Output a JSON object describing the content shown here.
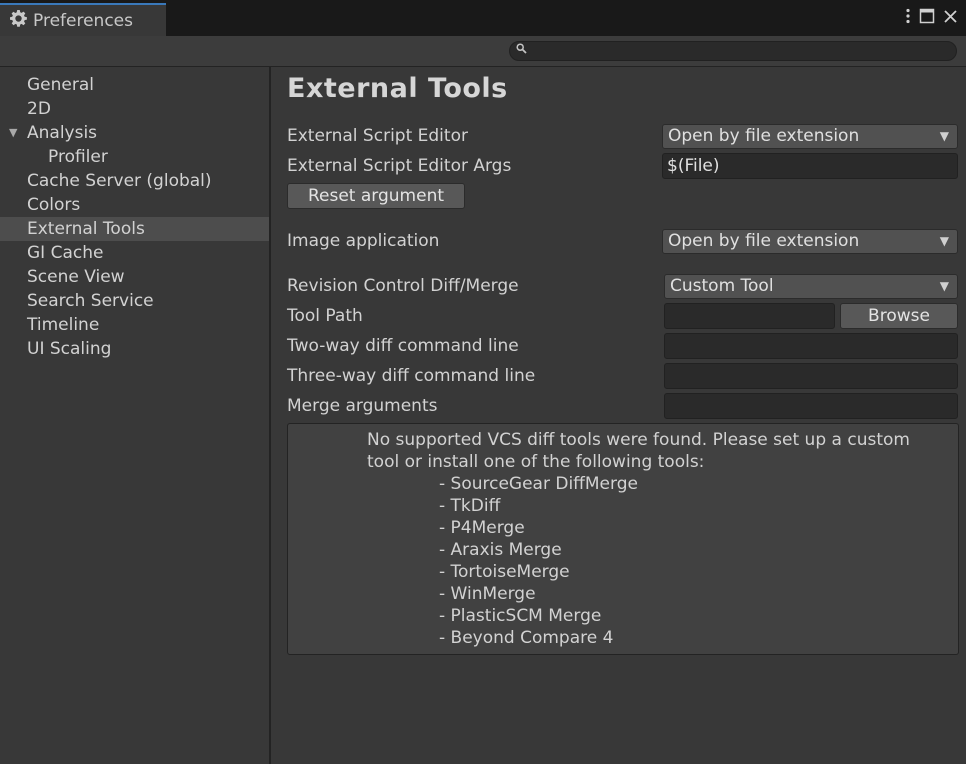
{
  "window": {
    "tab_title": "Preferences",
    "tab_icon": "gear-icon",
    "menu_icon": "kebab-menu-icon",
    "maximize_icon": "maximize-icon",
    "close_icon": "close-icon"
  },
  "search": {
    "value": "",
    "placeholder": "",
    "icon": "search-icon"
  },
  "sidebar": {
    "items": [
      {
        "label": "General"
      },
      {
        "label": "2D"
      },
      {
        "label": "Analysis",
        "expanded": true
      },
      {
        "label": "Profiler"
      },
      {
        "label": "Cache Server (global)"
      },
      {
        "label": "Colors"
      },
      {
        "label": "External Tools",
        "selected": true
      },
      {
        "label": "GI Cache"
      },
      {
        "label": "Scene View"
      },
      {
        "label": "Search Service"
      },
      {
        "label": "Timeline"
      },
      {
        "label": "UI Scaling"
      }
    ]
  },
  "main": {
    "title": "External Tools",
    "script_editor": {
      "label": "External Script Editor",
      "value": "Open by file extension"
    },
    "script_editor_args": {
      "label": "External Script Editor Args",
      "value": "$(File)"
    },
    "reset_button": "Reset argument",
    "image_application": {
      "label": "Image application",
      "value": "Open by file extension"
    },
    "revision_control": {
      "label": "Revision Control Diff/Merge",
      "value": "Custom Tool"
    },
    "tool_path": {
      "label": "Tool Path",
      "value": "",
      "browse_label": "Browse"
    },
    "two_way": {
      "label": "Two-way diff command line",
      "value": ""
    },
    "three_way": {
      "label": "Three-way diff command line",
      "value": ""
    },
    "merge_args": {
      "label": "Merge arguments",
      "value": ""
    },
    "help": {
      "message": "No supported VCS diff tools were found. Please set up a custom tool or install one of the following tools:",
      "tools": [
        "- SourceGear DiffMerge",
        "- TkDiff",
        "- P4Merge",
        "- Araxis Merge",
        "- TortoiseMerge",
        "- WinMerge",
        "- PlasticSCM Merge",
        "- Beyond Compare 4"
      ]
    }
  },
  "colors": {
    "background": "#383838",
    "titlebar": "#191919",
    "tab_accent": "#3a79bb",
    "selected_item": "#4d4d4d",
    "field": "#2a2a2a",
    "button": "#585858"
  }
}
